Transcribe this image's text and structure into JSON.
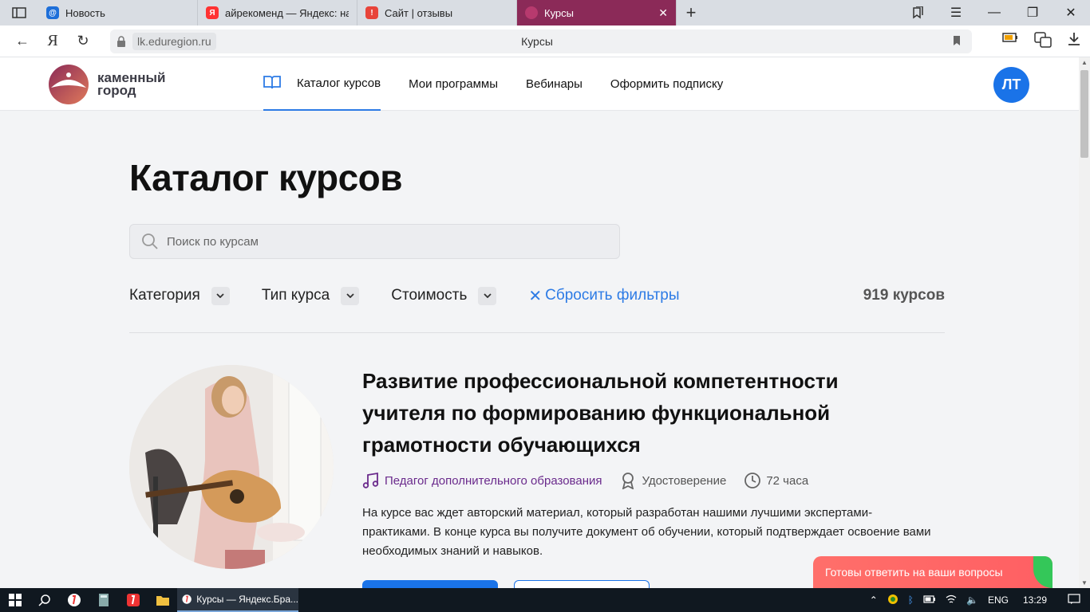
{
  "browser": {
    "tabs": [
      {
        "title": "Новость",
        "color": "#1e6fd9",
        "glyph": "@"
      },
      {
        "title": "айрекоменд — Яндекс: на",
        "color": "#f33",
        "glyph": "Я"
      },
      {
        "title": "Сайт | отзывы",
        "color": "#e8443a",
        "glyph": "!"
      },
      {
        "title": "Курсы",
        "color": "#b73a6e",
        "glyph": ""
      }
    ],
    "domain": "lk.eduregion.ru",
    "page_title": "Курсы",
    "ya_label": "Я"
  },
  "site": {
    "logo_line1": "каменный",
    "logo_line2": "город",
    "nav": [
      "Каталог курсов",
      "Мои программы",
      "Вебинары",
      "Оформить подписку"
    ],
    "avatar": "ЛТ"
  },
  "catalog": {
    "title": "Каталог курсов",
    "search_placeholder": "Поиск по курсам",
    "filters": [
      "Категория",
      "Тип курса",
      "Стоимость"
    ],
    "reset": "Сбросить фильтры",
    "count": "919 курсов"
  },
  "course": {
    "title": "Развитие профессиональной компетентности учителя по формированию функциональной грамотности обучающихся",
    "category": "Педагог дополнительного образования",
    "doc": "Удостоверение",
    "hours": "72 часа",
    "description": "На курсе вас ждет авторский материал, который разработан нашими лучшими экспертами-практиками. В конце курса вы получите документ об обучении, который подтверждает освоение вами необходимых знаний и навыков."
  },
  "chat": "Готовы ответить на ваши вопросы",
  "taskbar": {
    "app": "Курсы — Яндекс.Бра...",
    "lang": "ENG",
    "time": "13:29"
  }
}
